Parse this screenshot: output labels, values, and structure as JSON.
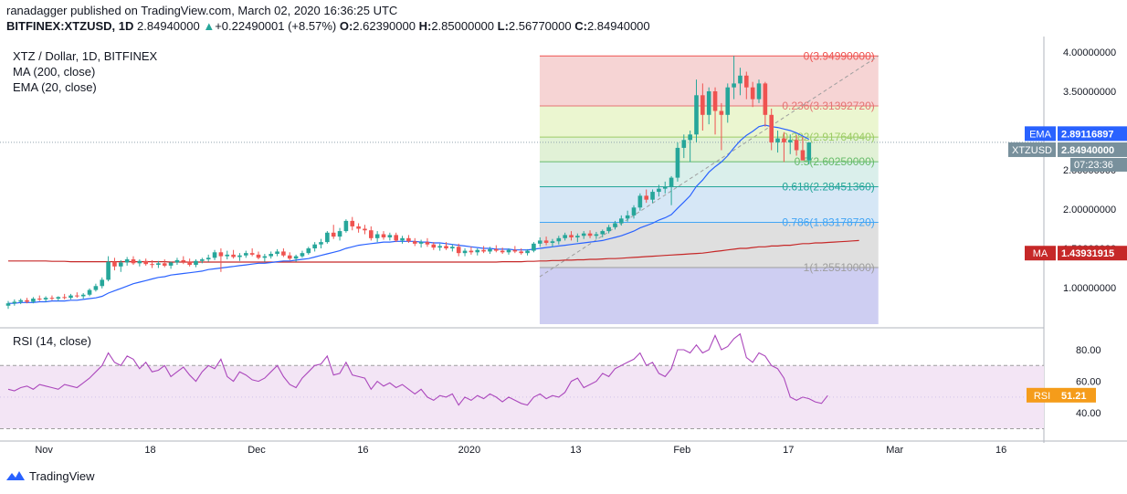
{
  "header": {
    "line1": "ranadagger published on TradingView.com, March 02, 2020 16:36:25 UTC",
    "symbol": "BITFINEX:XTZUSD, 1D",
    "price": "2.84940000",
    "change": "+0.22490001 (+8.57%)",
    "o_label": "O:",
    "o": "2.62390000",
    "h_label": "H:",
    "h": "2.85000000",
    "l_label": "L:",
    "l": "2.56770000",
    "c_label": "C:",
    "c": "2.84940000"
  },
  "legend": {
    "title": "XTZ / Dollar, 1D, BITFINEX",
    "ma": "MA (200, close)",
    "ema": "EMA (20, close)",
    "rsi": "RSI (14, close)"
  },
  "brand": {
    "name": "TradingView",
    "icon": "tradingview-logo-icon"
  },
  "colors": {
    "up": "#26a69a",
    "down": "#ef5350",
    "ema": "#2962ff",
    "ma": "#c62828",
    "rsi": "#ab47bc",
    "rsi_band": "#f3e5f5",
    "ema_tag": "#2962ff",
    "price_tag": "#78909c",
    "ma_tag": "#c62828"
  },
  "chart_data": {
    "type": "candlestick",
    "price_axis": {
      "ylim": [
        0.5,
        4.1
      ],
      "ticks": [
        1.0,
        1.5,
        2.0,
        2.5,
        3.0,
        3.5,
        4.0
      ],
      "tick_labels": [
        "1.00000000",
        "1.50000000",
        "2.00000000",
        "2.50000000",
        "3.00000000",
        "3.50000000",
        "4.00000000"
      ]
    },
    "x_axis": {
      "labels": [
        "Nov",
        "18",
        "Dec",
        "16",
        "2020",
        "13",
        "Feb",
        "17",
        "Mar",
        "16"
      ],
      "label_day_index": [
        6,
        23,
        40,
        57,
        74,
        91,
        108,
        125,
        142,
        159
      ]
    },
    "ohlc_base_day": 0,
    "ohlc": [
      [
        0.77,
        0.83,
        0.73,
        0.8
      ],
      [
        0.8,
        0.85,
        0.77,
        0.82
      ],
      [
        0.82,
        0.86,
        0.79,
        0.84
      ],
      [
        0.84,
        0.87,
        0.8,
        0.82
      ],
      [
        0.82,
        0.88,
        0.8,
        0.86
      ],
      [
        0.86,
        0.9,
        0.83,
        0.85
      ],
      [
        0.85,
        0.89,
        0.82,
        0.87
      ],
      [
        0.87,
        0.9,
        0.84,
        0.86
      ],
      [
        0.86,
        0.89,
        0.83,
        0.88
      ],
      [
        0.88,
        0.92,
        0.85,
        0.87
      ],
      [
        0.87,
        0.92,
        0.85,
        0.9
      ],
      [
        0.9,
        0.94,
        0.87,
        0.89
      ],
      [
        0.89,
        0.93,
        0.86,
        0.91
      ],
      [
        0.91,
        0.99,
        0.89,
        0.97
      ],
      [
        0.97,
        1.05,
        0.95,
        1.02
      ],
      [
        1.02,
        1.13,
        0.99,
        1.1
      ],
      [
        1.1,
        1.4,
        1.08,
        1.33
      ],
      [
        1.33,
        1.38,
        1.22,
        1.27
      ],
      [
        1.27,
        1.35,
        1.2,
        1.32
      ],
      [
        1.32,
        1.39,
        1.28,
        1.36
      ],
      [
        1.36,
        1.4,
        1.29,
        1.31
      ],
      [
        1.31,
        1.36,
        1.27,
        1.34
      ],
      [
        1.34,
        1.37,
        1.28,
        1.3
      ],
      [
        1.3,
        1.35,
        1.25,
        1.29
      ],
      [
        1.29,
        1.34,
        1.25,
        1.31
      ],
      [
        1.31,
        1.36,
        1.26,
        1.28
      ],
      [
        1.28,
        1.33,
        1.24,
        1.32
      ],
      [
        1.32,
        1.38,
        1.29,
        1.35
      ],
      [
        1.35,
        1.4,
        1.3,
        1.33
      ],
      [
        1.33,
        1.37,
        1.27,
        1.29
      ],
      [
        1.29,
        1.36,
        1.26,
        1.34
      ],
      [
        1.34,
        1.38,
        1.31,
        1.36
      ],
      [
        1.36,
        1.42,
        1.33,
        1.38
      ],
      [
        1.38,
        1.48,
        1.35,
        1.45
      ],
      [
        1.45,
        1.5,
        1.2,
        1.4
      ],
      [
        1.4,
        1.47,
        1.36,
        1.42
      ],
      [
        1.42,
        1.48,
        1.37,
        1.39
      ],
      [
        1.39,
        1.44,
        1.34,
        1.41
      ],
      [
        1.41,
        1.47,
        1.38,
        1.44
      ],
      [
        1.44,
        1.5,
        1.4,
        1.42
      ],
      [
        1.42,
        1.46,
        1.36,
        1.38
      ],
      [
        1.38,
        1.43,
        1.33,
        1.4
      ],
      [
        1.4,
        1.46,
        1.37,
        1.43
      ],
      [
        1.43,
        1.49,
        1.4,
        1.46
      ],
      [
        1.46,
        1.5,
        1.39,
        1.41
      ],
      [
        1.41,
        1.45,
        1.35,
        1.37
      ],
      [
        1.37,
        1.42,
        1.33,
        1.4
      ],
      [
        1.4,
        1.47,
        1.38,
        1.44
      ],
      [
        1.44,
        1.52,
        1.42,
        1.5
      ],
      [
        1.5,
        1.58,
        1.46,
        1.55
      ],
      [
        1.55,
        1.62,
        1.5,
        1.58
      ],
      [
        1.58,
        1.72,
        1.56,
        1.7
      ],
      [
        1.7,
        1.8,
        1.62,
        1.65
      ],
      [
        1.65,
        1.76,
        1.6,
        1.72
      ],
      [
        1.72,
        1.87,
        1.7,
        1.85
      ],
      [
        1.85,
        1.9,
        1.73,
        1.78
      ],
      [
        1.78,
        1.82,
        1.7,
        1.75
      ],
      [
        1.75,
        1.8,
        1.68,
        1.73
      ],
      [
        1.73,
        1.78,
        1.6,
        1.63
      ],
      [
        1.63,
        1.72,
        1.58,
        1.68
      ],
      [
        1.68,
        1.72,
        1.61,
        1.64
      ],
      [
        1.64,
        1.7,
        1.6,
        1.67
      ],
      [
        1.67,
        1.7,
        1.58,
        1.6
      ],
      [
        1.6,
        1.66,
        1.56,
        1.63
      ],
      [
        1.63,
        1.67,
        1.57,
        1.59
      ],
      [
        1.59,
        1.63,
        1.53,
        1.56
      ],
      [
        1.56,
        1.61,
        1.51,
        1.58
      ],
      [
        1.58,
        1.63,
        1.52,
        1.55
      ],
      [
        1.55,
        1.58,
        1.48,
        1.51
      ],
      [
        1.51,
        1.56,
        1.47,
        1.53
      ],
      [
        1.53,
        1.58,
        1.48,
        1.5
      ],
      [
        1.5,
        1.55,
        1.46,
        1.52
      ],
      [
        1.52,
        1.56,
        1.4,
        1.44
      ],
      [
        1.44,
        1.5,
        1.4,
        1.47
      ],
      [
        1.47,
        1.52,
        1.42,
        1.45
      ],
      [
        1.45,
        1.5,
        1.41,
        1.48
      ],
      [
        1.48,
        1.53,
        1.44,
        1.46
      ],
      [
        1.46,
        1.52,
        1.43,
        1.49
      ],
      [
        1.49,
        1.54,
        1.45,
        1.47
      ],
      [
        1.47,
        1.51,
        1.43,
        1.45
      ],
      [
        1.45,
        1.5,
        1.42,
        1.48
      ],
      [
        1.48,
        1.53,
        1.44,
        1.46
      ],
      [
        1.46,
        1.5,
        1.42,
        1.44
      ],
      [
        1.44,
        1.49,
        1.41,
        1.47
      ],
      [
        1.47,
        1.58,
        1.45,
        1.56
      ],
      [
        1.56,
        1.64,
        1.52,
        1.6
      ],
      [
        1.6,
        1.65,
        1.54,
        1.57
      ],
      [
        1.57,
        1.62,
        1.52,
        1.59
      ],
      [
        1.59,
        1.66,
        1.55,
        1.63
      ],
      [
        1.63,
        1.7,
        1.6,
        1.67
      ],
      [
        1.67,
        1.72,
        1.6,
        1.64
      ],
      [
        1.64,
        1.69,
        1.58,
        1.66
      ],
      [
        1.66,
        1.72,
        1.62,
        1.69
      ],
      [
        1.69,
        1.73,
        1.63,
        1.66
      ],
      [
        1.66,
        1.71,
        1.62,
        1.68
      ],
      [
        1.68,
        1.74,
        1.64,
        1.72
      ],
      [
        1.72,
        1.8,
        1.69,
        1.77
      ],
      [
        1.77,
        1.85,
        1.74,
        1.82
      ],
      [
        1.82,
        1.92,
        1.79,
        1.88
      ],
      [
        1.88,
        1.98,
        1.84,
        1.92
      ],
      [
        1.92,
        2.05,
        1.88,
        2.02
      ],
      [
        2.02,
        2.2,
        1.98,
        2.17
      ],
      [
        2.17,
        2.25,
        2.08,
        2.12
      ],
      [
        2.12,
        2.25,
        2.08,
        2.22
      ],
      [
        2.22,
        2.31,
        2.16,
        2.26
      ],
      [
        2.26,
        2.35,
        2.2,
        2.29
      ],
      [
        2.29,
        2.42,
        2.05,
        2.4
      ],
      [
        2.4,
        2.85,
        2.35,
        2.78
      ],
      [
        2.78,
        2.95,
        2.65,
        2.88
      ],
      [
        2.88,
        3.0,
        2.6,
        2.95
      ],
      [
        2.95,
        3.65,
        2.85,
        3.45
      ],
      [
        3.45,
        3.6,
        3.0,
        3.2
      ],
      [
        3.2,
        3.55,
        3.08,
        3.5
      ],
      [
        3.5,
        3.55,
        2.95,
        3.25
      ],
      [
        3.25,
        3.35,
        2.75,
        3.2
      ],
      [
        3.2,
        3.6,
        3.1,
        3.55
      ],
      [
        3.55,
        3.95,
        3.4,
        3.6
      ],
      [
        3.6,
        3.8,
        3.45,
        3.7
      ],
      [
        3.7,
        3.75,
        3.4,
        3.55
      ],
      [
        3.55,
        3.62,
        3.3,
        3.4
      ],
      [
        3.4,
        3.65,
        3.35,
        3.6
      ],
      [
        3.6,
        3.62,
        3.05,
        3.2
      ],
      [
        3.2,
        3.28,
        2.75,
        2.85
      ],
      [
        2.85,
        3.0,
        2.72,
        2.9
      ],
      [
        2.9,
        2.98,
        2.6,
        2.85
      ],
      [
        2.85,
        2.95,
        2.7,
        2.88
      ],
      [
        2.88,
        2.94,
        2.68,
        2.75
      ],
      [
        2.75,
        2.92,
        2.62,
        2.62
      ],
      [
        2.62,
        2.85,
        2.57,
        2.85
      ]
    ],
    "ma_200": [
      1.34,
      1.34,
      1.34,
      1.34,
      1.34,
      1.34,
      1.34,
      1.335,
      1.335,
      1.335,
      1.33,
      1.33,
      1.33,
      1.33,
      1.33,
      1.33,
      1.33,
      1.33,
      1.33,
      1.33,
      1.33,
      1.33,
      1.33,
      1.33,
      1.33,
      1.33,
      1.325,
      1.325,
      1.325,
      1.325,
      1.325,
      1.325,
      1.325,
      1.325,
      1.325,
      1.325,
      1.325,
      1.325,
      1.325,
      1.325,
      1.325,
      1.325,
      1.325,
      1.325,
      1.325,
      1.325,
      1.325,
      1.325,
      1.325,
      1.325,
      1.325,
      1.325,
      1.325,
      1.325,
      1.325,
      1.325,
      1.325,
      1.325,
      1.325,
      1.325,
      1.325,
      1.325,
      1.325,
      1.325,
      1.325,
      1.325,
      1.325,
      1.325,
      1.325,
      1.325,
      1.325,
      1.325,
      1.325,
      1.325,
      1.325,
      1.325,
      1.325,
      1.325,
      1.325,
      1.33,
      1.33,
      1.33,
      1.33,
      1.335,
      1.335,
      1.34,
      1.34,
      1.345,
      1.345,
      1.35,
      1.35,
      1.355,
      1.355,
      1.36,
      1.36,
      1.365,
      1.37,
      1.37,
      1.375,
      1.38,
      1.385,
      1.39,
      1.395,
      1.4,
      1.405,
      1.41,
      1.415,
      1.42,
      1.425,
      1.43,
      1.435,
      1.44,
      1.45,
      1.46,
      1.47,
      1.48,
      1.49,
      1.5,
      1.5,
      1.51,
      1.52,
      1.52,
      1.53,
      1.53,
      1.54,
      1.54,
      1.55,
      1.56,
      1.56,
      1.57,
      1.57,
      1.575,
      1.58,
      1.585,
      1.59,
      1.595,
      1.6
    ],
    "ema_20": [
      0.8,
      0.8,
      0.81,
      0.81,
      0.81,
      0.82,
      0.82,
      0.83,
      0.83,
      0.83,
      0.84,
      0.84,
      0.85,
      0.86,
      0.87,
      0.89,
      0.93,
      0.96,
      0.99,
      1.02,
      1.05,
      1.07,
      1.09,
      1.11,
      1.13,
      1.14,
      1.16,
      1.17,
      1.18,
      1.19,
      1.2,
      1.21,
      1.23,
      1.24,
      1.25,
      1.26,
      1.27,
      1.28,
      1.29,
      1.3,
      1.31,
      1.31,
      1.32,
      1.33,
      1.34,
      1.34,
      1.35,
      1.36,
      1.37,
      1.39,
      1.41,
      1.43,
      1.45,
      1.47,
      1.5,
      1.52,
      1.54,
      1.55,
      1.56,
      1.57,
      1.58,
      1.58,
      1.59,
      1.59,
      1.59,
      1.59,
      1.58,
      1.58,
      1.57,
      1.57,
      1.56,
      1.55,
      1.54,
      1.53,
      1.52,
      1.51,
      1.5,
      1.5,
      1.49,
      1.49,
      1.49,
      1.48,
      1.48,
      1.48,
      1.49,
      1.5,
      1.51,
      1.52,
      1.53,
      1.54,
      1.55,
      1.56,
      1.57,
      1.58,
      1.59,
      1.6,
      1.62,
      1.64,
      1.66,
      1.69,
      1.72,
      1.76,
      1.79,
      1.82,
      1.86,
      1.89,
      1.93,
      2.01,
      2.09,
      2.17,
      2.29,
      2.37,
      2.47,
      2.54,
      2.6,
      2.68,
      2.78,
      2.87,
      2.94,
      2.99,
      3.05,
      3.07,
      3.05,
      3.04,
      3.02,
      3.0,
      2.97,
      2.93,
      2.89
    ],
    "fibonacci": {
      "start_day": 87,
      "end_day": 135,
      "levels": [
        {
          "ratio": 0,
          "price": 3.9499,
          "label": "0(3.94990000)",
          "color": "#ef5350"
        },
        {
          "ratio": 0.236,
          "price": 3.3139272,
          "label": "0.236(3.31392720)",
          "color": "#e57373"
        },
        {
          "ratio": 0.382,
          "price": 2.9176404,
          "label": "0.382(2.91764040)",
          "color": "#9ccc65"
        },
        {
          "ratio": 0.5,
          "price": 2.6025,
          "label": "0.5(2.60250000)",
          "color": "#66bb6a"
        },
        {
          "ratio": 0.618,
          "price": 2.2845136,
          "label": "0.618(2.28451360)",
          "color": "#26a69a"
        },
        {
          "ratio": 0.786,
          "price": 1.8317872,
          "label": "0.786(1.83178720)",
          "color": "#42a5f5"
        },
        {
          "ratio": 1,
          "price": 1.2551,
          "label": "1(1.25510000)",
          "color": "#9e9e9e"
        }
      ],
      "fills": [
        "#f4cccc",
        "#e8f4c8",
        "#dcefcf",
        "#d4ece8",
        "#cfe3f5",
        "#d9d9d9",
        "#c5c5f0"
      ]
    },
    "tags": [
      {
        "label": "EMA",
        "value": "2.89116897",
        "price": 2.89116897,
        "kind": "ema"
      },
      {
        "label": "XTZUSD",
        "value": "2.84940000",
        "price": 2.8494,
        "kind": "price",
        "countdown": "07:23:36"
      },
      {
        "label": "MA",
        "value": "1.43931915",
        "price": 1.43931915,
        "kind": "ma"
      }
    ],
    "rsi": {
      "ylim": [
        28,
        95
      ],
      "bands": [
        30,
        70
      ],
      "ticks": [
        40,
        60,
        80
      ],
      "tick_labels": [
        "40.00",
        "60.00",
        "80.00"
      ],
      "last_label": "RSI",
      "last_value": "51.21",
      "last": 51.21,
      "values": [
        55,
        54,
        56,
        57,
        55,
        58,
        57,
        56,
        55,
        58,
        57,
        56,
        59,
        62,
        66,
        70,
        78,
        72,
        70,
        76,
        74,
        68,
        72,
        66,
        67,
        70,
        63,
        66,
        69,
        64,
        60,
        66,
        70,
        68,
        74,
        63,
        60,
        66,
        64,
        61,
        60,
        62,
        66,
        70,
        63,
        58,
        56,
        62,
        66,
        70,
        71,
        76,
        64,
        65,
        72,
        64,
        63,
        62,
        55,
        60,
        57,
        59,
        56,
        58,
        55,
        52,
        55,
        50,
        48,
        51,
        50,
        52,
        45,
        50,
        48,
        51,
        49,
        52,
        50,
        47,
        50,
        48,
        46,
        45,
        50,
        52,
        49,
        51,
        50,
        53,
        60,
        62,
        56,
        58,
        60,
        65,
        63,
        68,
        70,
        72,
        74,
        78,
        70,
        72,
        65,
        63,
        68,
        80,
        80,
        78,
        83,
        78,
        80,
        89,
        80,
        82,
        87,
        90,
        75,
        72,
        78,
        76,
        70,
        68,
        62,
        50,
        48,
        50,
        49,
        47,
        46,
        51
      ]
    }
  }
}
